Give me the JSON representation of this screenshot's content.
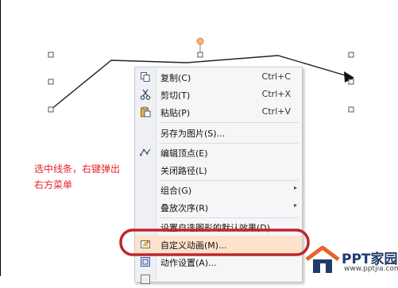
{
  "annotation": {
    "line1": "选中线条，右键弹出",
    "line2": "右方菜单"
  },
  "context_menu": {
    "items": [
      {
        "label": "复制(C)",
        "shortcut": "Ctrl+C",
        "icon": "copy-icon"
      },
      {
        "label": "剪切(T)",
        "shortcut": "Ctrl+X",
        "icon": "scissors-icon"
      },
      {
        "label": "粘贴(P)",
        "shortcut": "Ctrl+V",
        "icon": "paste-icon"
      },
      {
        "label": "另存为图片(S)...",
        "shortcut": "",
        "icon": ""
      },
      {
        "label": "编辑顶点(E)",
        "shortcut": "",
        "icon": "edit-vertices-icon"
      },
      {
        "label": "关闭路径(L)",
        "shortcut": "",
        "icon": ""
      },
      {
        "label": "组合(G)",
        "shortcut": "",
        "icon": "",
        "submenu": true
      },
      {
        "label": "叠放次序(R)",
        "shortcut": "",
        "icon": "",
        "submenu": true
      },
      {
        "label": "设置自选图形的默认效果(D)",
        "shortcut": "",
        "icon": ""
      },
      {
        "label": "自定义动画(M)...",
        "shortcut": "",
        "icon": "custom-animation-icon",
        "highlighted": true
      },
      {
        "label": "动作设置(A)...",
        "shortcut": "",
        "icon": "action-settings-icon"
      }
    ]
  },
  "logo": {
    "brand": "PPT家园",
    "url": "www.pptjia.com"
  },
  "colors": {
    "annotation": "#e8232a",
    "highlight_ring": "#c0252a",
    "rotation_handle": "#f0a050",
    "menu_highlight": "#ffe2cc"
  }
}
